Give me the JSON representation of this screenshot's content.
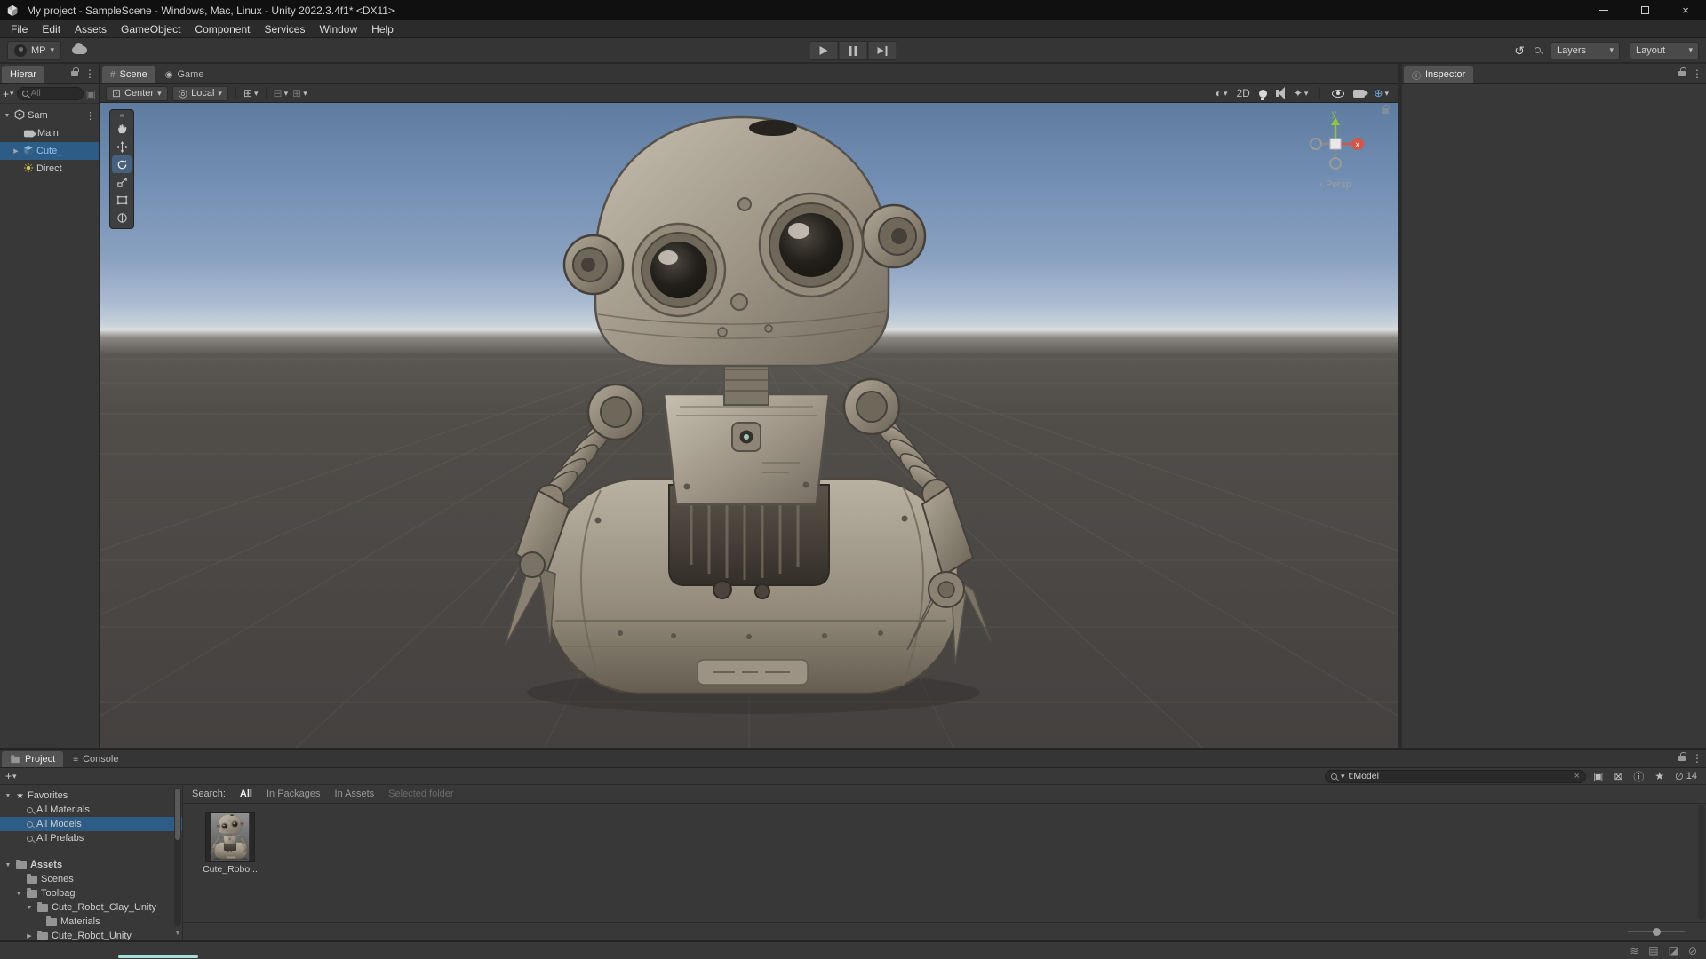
{
  "window": {
    "title": "My project - SampleScene - Windows, Mac, Linux - Unity 2022.3.4f1* <DX11>"
  },
  "menubar": {
    "items": [
      "File",
      "Edit",
      "Assets",
      "GameObject",
      "Component",
      "Services",
      "Window",
      "Help"
    ]
  },
  "toolbar": {
    "account_label": "MP",
    "layers_label": "Layers",
    "layout_label": "Layout"
  },
  "hierarchy": {
    "tab": "Hierar",
    "search_placeholder": "All",
    "items": [
      {
        "label": "Sam"
      },
      {
        "label": "Main"
      },
      {
        "label": "Cute_"
      },
      {
        "label": "Direct"
      }
    ]
  },
  "scene": {
    "tab_scene": "Scene",
    "tab_game": "Game",
    "pivot_label": "Center",
    "space_label": "Local",
    "mode_2d": "2D",
    "persp_label": "Persp",
    "axis_x": "x",
    "axis_y": "y"
  },
  "inspector": {
    "tab": "Inspector"
  },
  "project": {
    "tab_project": "Project",
    "tab_console": "Console",
    "search_value": "t:Model",
    "hidden_count": "14",
    "search_label": "Search:",
    "scopes": [
      "All",
      "In Packages",
      "In Assets",
      "Selected folder"
    ],
    "favorites_label": "Favorites",
    "favorites": [
      {
        "label": "All Materials"
      },
      {
        "label": "All Models"
      },
      {
        "label": "All Prefabs"
      }
    ],
    "assets_label": "Assets",
    "tree": [
      {
        "label": "Scenes"
      },
      {
        "label": "Toolbag"
      },
      {
        "label": "Cute_Robot_Clay_Unity"
      },
      {
        "label": "Materials"
      },
      {
        "label": "Cute_Robot_Unity"
      }
    ],
    "asset_name": "Cute_Robo..."
  },
  "colors": {
    "selection": "#2D5C87",
    "prefab_text": "#8FC3F2",
    "accent_blue": "#6FA8DC",
    "axis_x_red": "#D4554A",
    "axis_y_green": "#97C23C"
  },
  "icons": {
    "dropdown": "▾",
    "more": "⋮",
    "close": "×",
    "plus": "+",
    "star": "★",
    "history": "↺",
    "shading": "◐",
    "fx": "✦",
    "gizmos": "⊕",
    "hidden": "∅",
    "info": "ⓘ",
    "grid": "⊞",
    "grid2": "⊟",
    "pivot": "⊡",
    "globe": "◎",
    "hash": "#",
    "game": "◉",
    "open_arrow": "▼",
    "closed_arrow": "▶",
    "persp_arrow": "‹",
    "search_box": "▣",
    "tag": "⊠",
    "grip": "≡",
    "console": "≡",
    "status_1": "≋",
    "status_2": "▤",
    "status_3": "◪",
    "status_4": "⊘"
  }
}
